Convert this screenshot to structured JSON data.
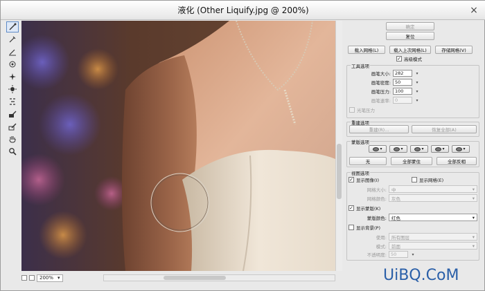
{
  "window": {
    "title": "液化 (Other Liquify.jpg @ 200%)",
    "close_icon": "×"
  },
  "toolbar": {
    "tools": [
      "forward-warp-icon",
      "reconstruct-icon",
      "smooth-icon",
      "twirl-icon",
      "pucker-icon",
      "bloat-icon",
      "push-left-icon",
      "freeze-mask-icon",
      "thaw-mask-icon",
      "hand-icon",
      "zoom-icon"
    ]
  },
  "status": {
    "zoom": "200%"
  },
  "buttons": {
    "ok": "确定",
    "reset": "复位",
    "load_mesh": "载入网格(L)",
    "load_last_mesh": "载入上次网格(L)",
    "save_mesh": "存储网格(V)"
  },
  "advanced_mode": {
    "label": "高级模式",
    "checked": true
  },
  "tool_options": {
    "title": "工具选项",
    "brush_size": {
      "label": "画笔大小:",
      "value": "282"
    },
    "brush_density": {
      "label": "画笔密度:",
      "value": "50"
    },
    "brush_pressure": {
      "label": "画笔压力:",
      "value": "100"
    },
    "brush_rate": {
      "label": "画笔速率:",
      "value": "0"
    },
    "stylus_pressure": {
      "label": "光笔压力"
    }
  },
  "reconstruct_options": {
    "title": "重建选项",
    "reconstruct": "重建(R)...",
    "restore_all": "恢复全部(A)"
  },
  "mask_options": {
    "title": "蒙版选项",
    "none": "无",
    "mask_all": "全部蒙住",
    "invert_all": "全部反相"
  },
  "view_options": {
    "title": "视图选项",
    "show_image": {
      "label": "显示图像(I)",
      "checked": true
    },
    "show_mesh": {
      "label": "显示网格(E)",
      "checked": false
    },
    "mesh_size": {
      "label": "网格大小:",
      "value": "中"
    },
    "mesh_color": {
      "label": "网格颜色:",
      "value": "灰色"
    },
    "show_mask": {
      "label": "显示蒙版(K)",
      "checked": true
    },
    "mask_color": {
      "label": "蒙版颜色:",
      "value": "红色"
    },
    "show_backdrop": {
      "label": "显示背景(P)",
      "checked": false
    },
    "use": {
      "label": "使用:",
      "value": "所有图层"
    },
    "mode": {
      "label": "模式:",
      "value": "前面"
    },
    "opacity": {
      "label": "不透明度:",
      "value": "50"
    }
  },
  "watermark": "UiBQ.CoM",
  "colors": {
    "accent": "#5d8bc8",
    "watermark": "#2a5fa8"
  }
}
